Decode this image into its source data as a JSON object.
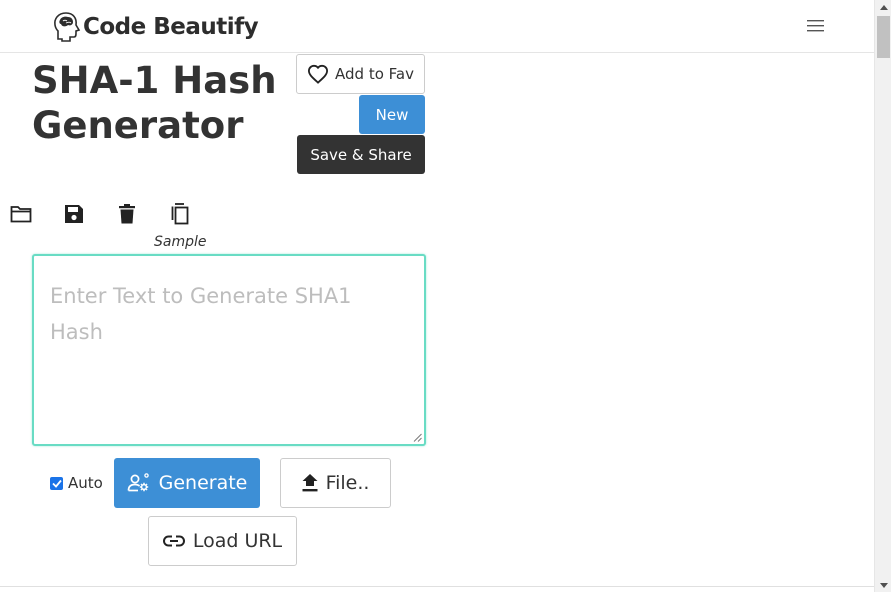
{
  "header": {
    "brand_name": "Code Beautify",
    "brand_logo_icon": "brain-head-icon",
    "menu_icon": "hamburger-icon"
  },
  "page": {
    "title": "SHA-1 Hash Generator"
  },
  "actions": {
    "add_fav_label": "Add to Fav",
    "new_label": "New",
    "save_share_label": "Save & Share"
  },
  "toolbar": {
    "items": [
      {
        "icon": "folder-open-icon"
      },
      {
        "icon": "save-icon"
      },
      {
        "icon": "trash-icon"
      },
      {
        "icon": "copy-icon"
      }
    ],
    "sample_label": "Sample"
  },
  "input": {
    "placeholder": "Enter Text to Generate SHA1 Hash",
    "value": ""
  },
  "controls": {
    "auto_label": "Auto",
    "auto_checked": true,
    "generate_label": "Generate",
    "file_label": "File..",
    "load_url_label": "Load URL"
  },
  "colors": {
    "primary": "#3d8fd6",
    "dark": "#333333",
    "focus_border": "#69dcc4"
  }
}
